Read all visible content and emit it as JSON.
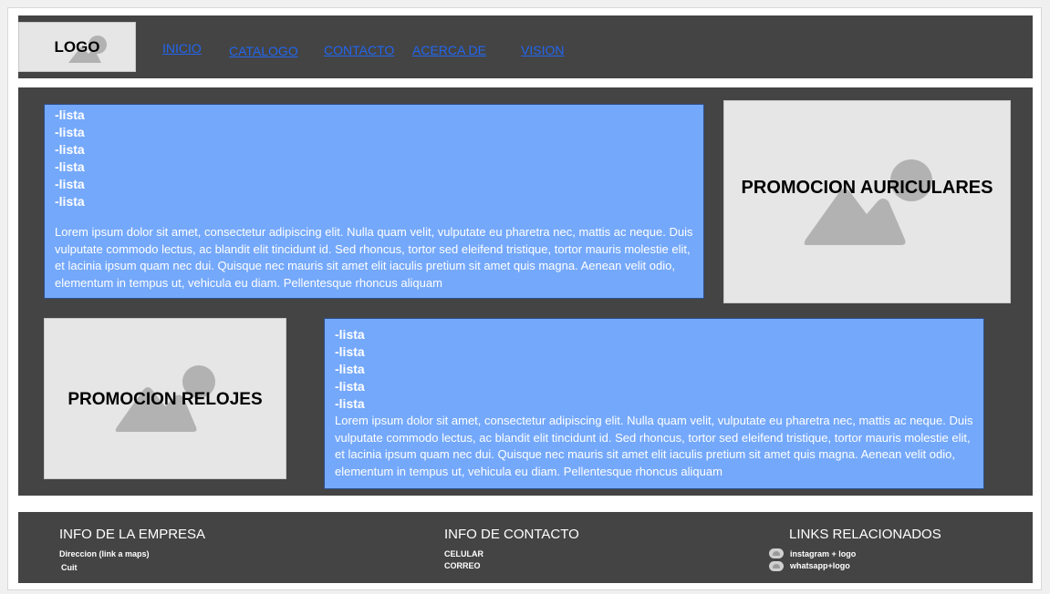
{
  "header": {
    "logo": "LOGO",
    "nav": [
      "INICIO",
      "CATALOGO",
      "CONTACTO",
      "ACERCA DE",
      "VISION"
    ]
  },
  "main": {
    "block1": {
      "list": [
        "-lista",
        "-lista",
        "-lista",
        "-lista",
        "-lista",
        "-lista"
      ],
      "text": "Lorem ipsum dolor sit amet, consectetur adipiscing elit. Nulla quam velit, vulputate eu pharetra nec, mattis ac neque. Duis vulputate commodo lectus, ac blandit elit tincidunt id. Sed rhoncus, tortor sed eleifend tristique, tortor mauris molestie elit, et lacinia ipsum quam nec dui. Quisque nec mauris sit amet elit iaculis pretium sit amet quis magna. Aenean velit odio, elementum in tempus ut, vehicula eu diam. Pellentesque rhoncus aliquam"
    },
    "promo_auriculares": "PROMOCION AURICULARES",
    "promo_relojes": "PROMOCION RELOJES",
    "block2": {
      "list": [
        "-lista",
        "-lista",
        "-lista",
        "-lista",
        "-lista"
      ],
      "text": "Lorem ipsum dolor sit amet, consectetur adipiscing elit. Nulla quam velit, vulputate eu pharetra nec, mattis ac neque. Duis vulputate commodo lectus, ac blandit elit tincidunt id. Sed rhoncus, tortor sed eleifend tristique, tortor mauris molestie elit, et lacinia ipsum quam nec dui. Quisque nec mauris sit amet elit iaculis pretium sit amet quis magna. Aenean velit odio, elementum in tempus ut, vehicula eu diam. Pellentesque rhoncus aliquam"
    }
  },
  "footer": {
    "empresa": {
      "title": "INFO DE LA EMPRESA",
      "items": [
        "Direccion (link a maps)",
        "Cuit"
      ]
    },
    "contacto": {
      "title": "INFO DE CONTACTO",
      "items": [
        "CELULAR",
        "CORREO"
      ]
    },
    "links": {
      "title": "LINKS RELACIONADOS",
      "items": [
        "instagram + logo",
        "whatsapp+logo"
      ]
    }
  },
  "colors": {
    "dark_panel": "#444444",
    "content_blue": "#74a8fa",
    "placeholder_gray": "#e6e6e6",
    "link_blue": "#2266ee"
  },
  "icons": [
    "image-placeholder-icon",
    "instagram-icon",
    "whatsapp-icon"
  ]
}
